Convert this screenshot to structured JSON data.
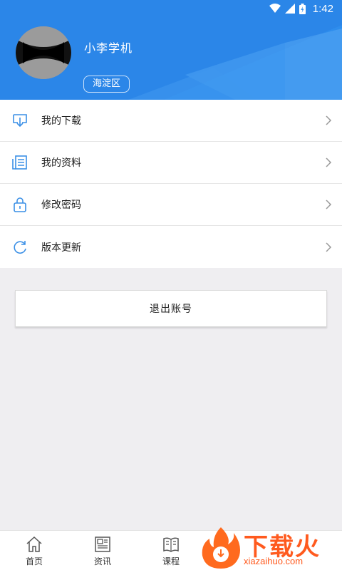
{
  "status_bar": {
    "time": "1:42"
  },
  "profile": {
    "username": "小李学机",
    "district": "海淀区"
  },
  "menu": {
    "items": [
      {
        "label": "我的下载",
        "icon": "download-icon"
      },
      {
        "label": "我的资料",
        "icon": "document-icon"
      },
      {
        "label": "修改密码",
        "icon": "lock-icon"
      },
      {
        "label": "版本更新",
        "icon": "refresh-icon"
      }
    ]
  },
  "logout": {
    "label": "退出账号"
  },
  "bottom_nav": {
    "items": [
      {
        "label": "首页",
        "icon": "home-icon"
      },
      {
        "label": "资讯",
        "icon": "news-icon"
      },
      {
        "label": "课程",
        "icon": "book-icon"
      }
    ]
  },
  "watermark": {
    "text": "下载火",
    "url": "xiazaihuo.com"
  },
  "colors": {
    "header_blue": "#2e8ded",
    "icon_blue": "#3a8fe6",
    "watermark_orange": "#ff5a1e"
  }
}
